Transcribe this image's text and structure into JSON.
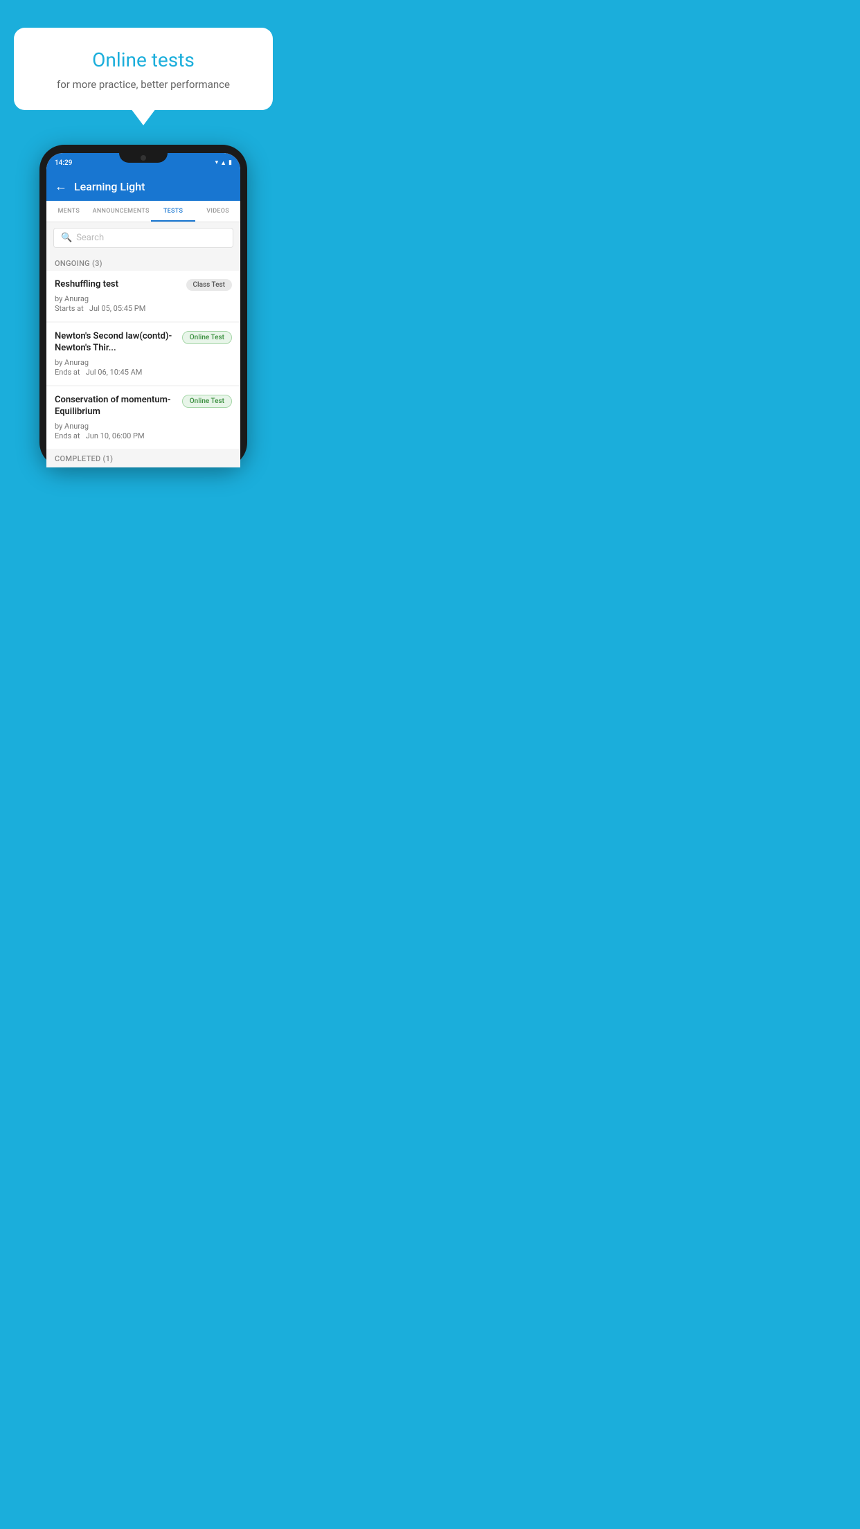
{
  "hero": {
    "title": "Online tests",
    "subtitle": "for more practice, better performance"
  },
  "status_bar": {
    "time": "14:29",
    "icons": [
      "wifi",
      "signal",
      "battery"
    ]
  },
  "app": {
    "title": "Learning Light",
    "back_label": "←"
  },
  "tabs": [
    {
      "label": "MENTS",
      "active": false
    },
    {
      "label": "ANNOUNCEMENTS",
      "active": false
    },
    {
      "label": "TESTS",
      "active": true
    },
    {
      "label": "VIDEOS",
      "active": false
    }
  ],
  "search": {
    "placeholder": "Search"
  },
  "ongoing_section": {
    "label": "ONGOING (3)",
    "tests": [
      {
        "title": "Reshuffling test",
        "badge": "Class Test",
        "badge_type": "class",
        "by": "by Anurag",
        "time_label": "Starts at",
        "time": "Jul 05, 05:45 PM"
      },
      {
        "title": "Newton's Second law(contd)-Newton's Thir...",
        "badge": "Online Test",
        "badge_type": "online",
        "by": "by Anurag",
        "time_label": "Ends at",
        "time": "Jul 06, 10:45 AM"
      },
      {
        "title": "Conservation of momentum-Equilibrium",
        "badge": "Online Test",
        "badge_type": "online",
        "by": "by Anurag",
        "time_label": "Ends at",
        "time": "Jun 10, 06:00 PM"
      }
    ]
  },
  "completed_section": {
    "label": "COMPLETED (1)"
  }
}
